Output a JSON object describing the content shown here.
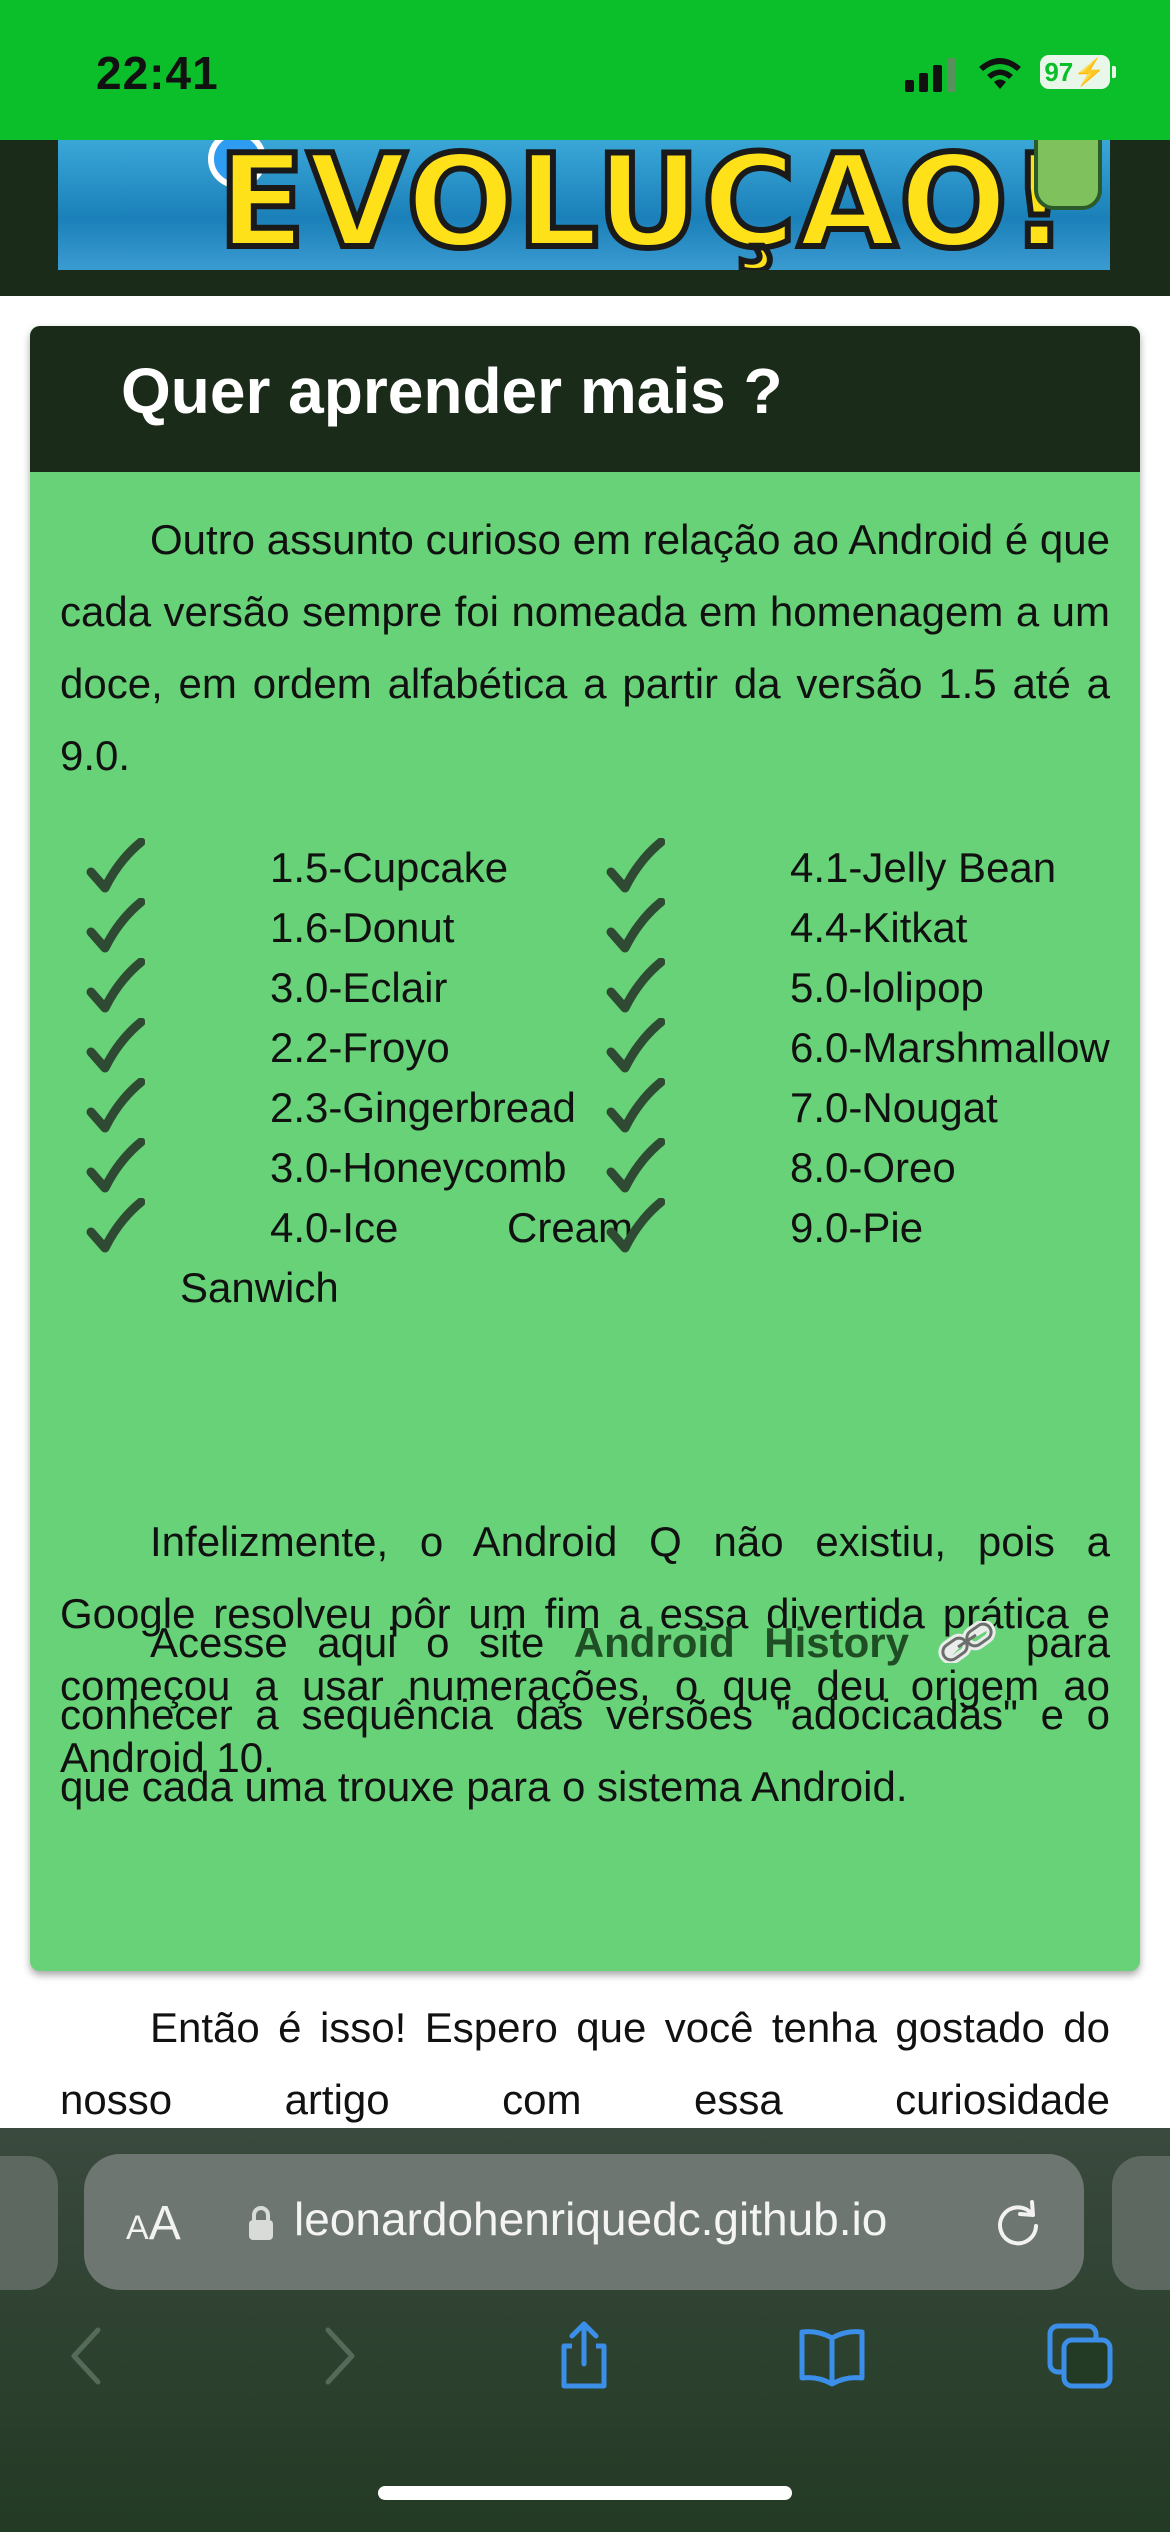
{
  "status_bar": {
    "time": "22:41",
    "battery": "97"
  },
  "banner": {
    "text": "EVOLUÇAO!"
  },
  "card": {
    "title": "Quer aprender mais ?",
    "intro": "Outro assunto curioso em relação ao Android é que cada versão sempre foi nomeada em homenagem a um doce, em ordem alfabética a partir da versão 1.5 até a 9.0.",
    "versions_left": [
      "1.5-Cupcake",
      "1.6-Donut",
      "3.0-Eclair",
      "2.2-Froyo",
      "2.3-Gingerbread",
      "3.0-Honeycomb"
    ],
    "versions_left_last": {
      "part1": "4.0-Ice",
      "part2": "Cream",
      "part3": "Sanwich"
    },
    "versions_right": [
      "4.1-Jelly Bean",
      "4.4-Kitkat",
      "5.0-lolipop",
      "6.0-Marshmallow",
      "7.0-Nougat",
      "8.0-Oreo",
      "9.0-Pie"
    ],
    "para2": "Infelizmente, o Android Q não existiu, pois a Google resolveu pôr um fim a essa divertida prática e começou a usar numerações, o que deu origem ao Android 10.",
    "para3_before": "Acesse aqui o site",
    "para3_link": "Android History",
    "para3_after": "para conhecer a sequência das versões \"adocicadas\" e o que cada uma trouxe para o sistema Android."
  },
  "after_card": {
    "text": "Então é isso! Espero que você tenha gostado do nosso artigo com essa curiosidade"
  },
  "browser": {
    "aa_label_small": "A",
    "aa_label_large": "A",
    "url": "leonardohenriquedc.github.io"
  },
  "colors": {
    "status_green": "#0bbf2a",
    "card_green": "#67d277",
    "dark_header": "#1b2b19",
    "accent_blue": "#3b8fe8"
  },
  "icons": [
    "signal-icon",
    "wifi-icon",
    "battery-icon",
    "check-icon",
    "link-icon",
    "lock-icon",
    "reload-icon",
    "back-icon",
    "forward-icon",
    "share-icon",
    "bookmarks-icon",
    "tabs-icon"
  ]
}
